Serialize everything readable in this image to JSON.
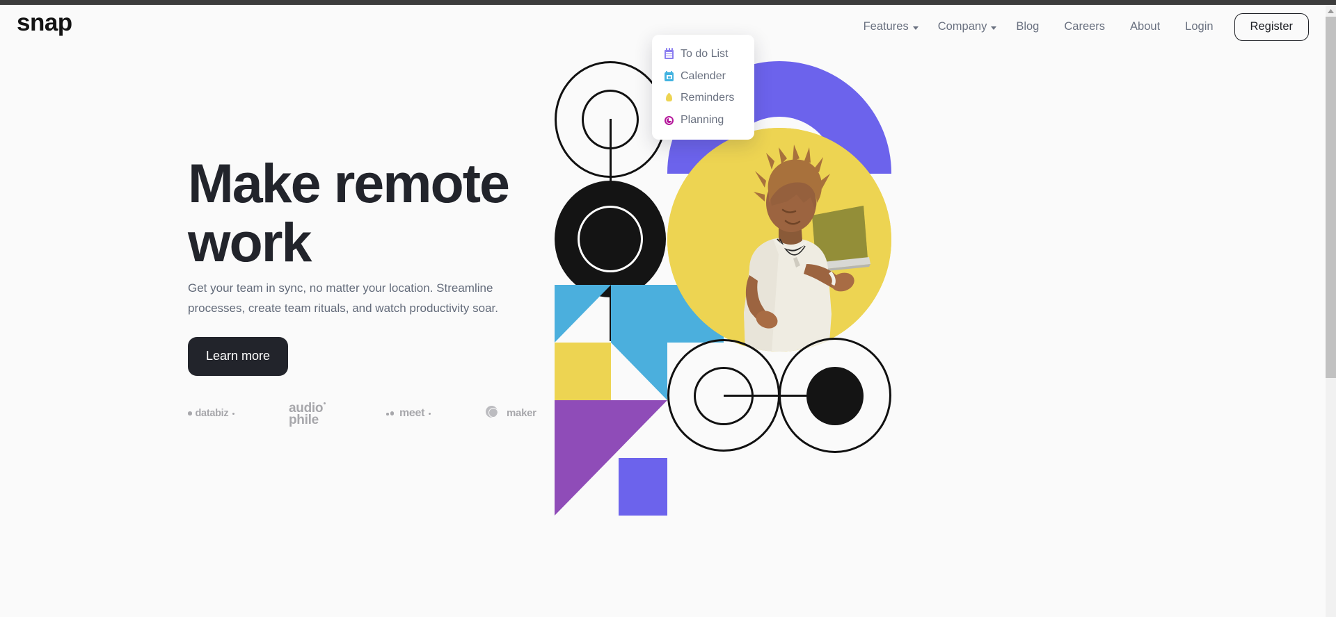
{
  "browser": {
    "scrollbar": {
      "up_arrow_icon": "triangle-up-icon"
    }
  },
  "navbar": {
    "logo": "snap",
    "items": [
      {
        "label": "Features",
        "has_dropdown": true
      },
      {
        "label": "Company",
        "has_dropdown": true
      },
      {
        "label": "Blog",
        "has_dropdown": false
      },
      {
        "label": "Careers",
        "has_dropdown": false
      },
      {
        "label": "About",
        "has_dropdown": false
      },
      {
        "label": "Login",
        "has_dropdown": false
      }
    ],
    "register_label": "Register"
  },
  "features_dropdown": {
    "open": true,
    "items": [
      {
        "label": "To do List",
        "icon": "todo-list-icon",
        "icon_color": "#8b7ef0"
      },
      {
        "label": "Calender",
        "icon": "calendar-icon",
        "icon_color": "#43b3e0"
      },
      {
        "label": "Reminders",
        "icon": "bell-icon",
        "icon_color": "#edd452"
      },
      {
        "label": "Planning",
        "icon": "clock-icon",
        "icon_color": "#b5189b"
      }
    ]
  },
  "hero": {
    "title": "Make remote work",
    "description": "Get your team in sync, no matter your location. Streamline processes, create team rituals, and watch productivity soar.",
    "cta_label": "Learn more"
  },
  "clients": [
    {
      "name": "databiz"
    },
    {
      "name": "audio",
      "name_line2": "phile"
    },
    {
      "name": "meet"
    },
    {
      "name": "maker"
    }
  ],
  "colors": {
    "page_background": "#fafafa",
    "text_dark": "#22242b",
    "text_muted": "#636b7a",
    "indigo": "#6c63ec",
    "yellow": "#edd452",
    "cyan": "#4bafdd",
    "purple": "#8f4cb8",
    "black": "#141414"
  }
}
